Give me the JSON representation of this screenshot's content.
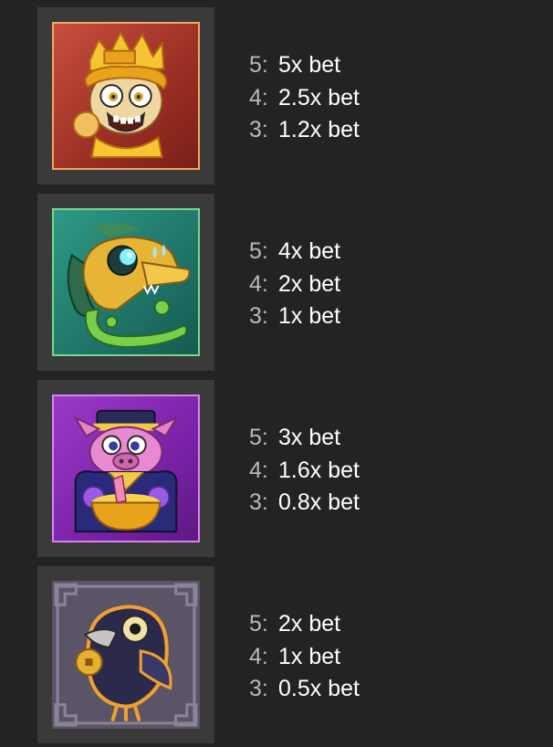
{
  "paytable": {
    "symbols": [
      {
        "icon": "golden-monkey-king-icon",
        "border_color": "#f0a860",
        "payouts": [
          {
            "count": "5:",
            "value": "5x bet"
          },
          {
            "count": "4:",
            "value": "2.5x bet"
          },
          {
            "count": "3:",
            "value": "1.2x bet"
          }
        ]
      },
      {
        "icon": "green-dragon-icon",
        "border_color": "#7ad68c",
        "payouts": [
          {
            "count": "5:",
            "value": "4x bet"
          },
          {
            "count": "4:",
            "value": "2x bet"
          },
          {
            "count": "3:",
            "value": "1x bet"
          }
        ]
      },
      {
        "icon": "pig-with-treasure-icon",
        "border_color": "#d884f0",
        "payouts": [
          {
            "count": "5:",
            "value": "3x bet"
          },
          {
            "count": "4:",
            "value": "1.6x bet"
          },
          {
            "count": "3:",
            "value": "0.8x bet"
          }
        ]
      },
      {
        "icon": "black-crow-icon",
        "border_color": "#8c8296",
        "payouts": [
          {
            "count": "5:",
            "value": "2x bet"
          },
          {
            "count": "4:",
            "value": "1x bet"
          },
          {
            "count": "3:",
            "value": "0.5x bet"
          }
        ]
      }
    ]
  }
}
